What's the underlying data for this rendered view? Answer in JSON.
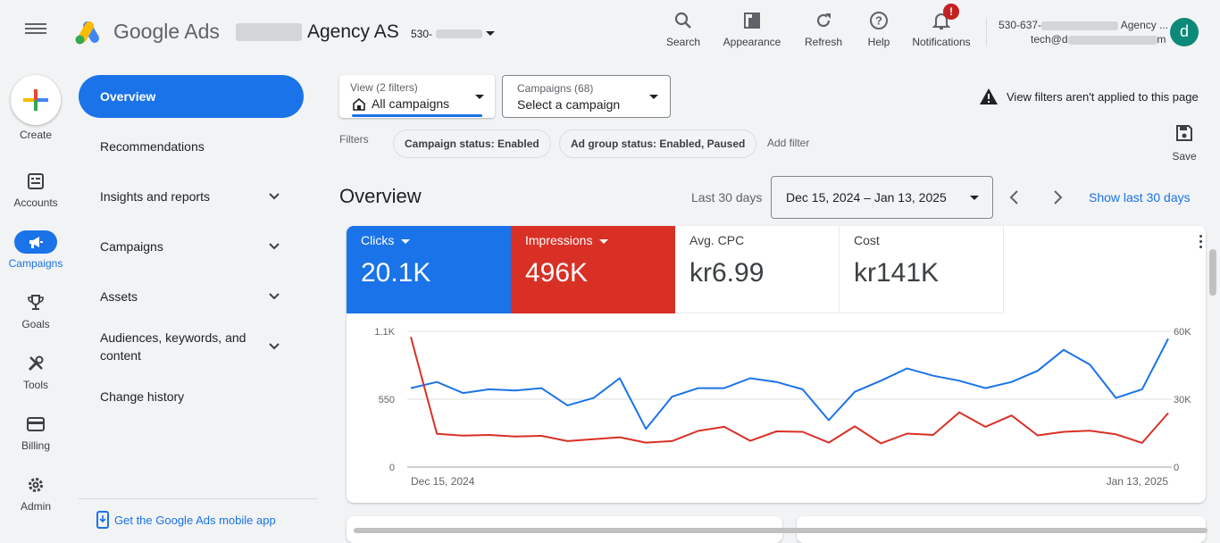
{
  "header": {
    "brand": "Google Ads",
    "account_name": "Agency AS",
    "account_id": "530-",
    "tools": [
      {
        "name": "search",
        "label": "Search"
      },
      {
        "name": "appearance",
        "label": "Appearance"
      },
      {
        "name": "refresh",
        "label": "Refresh"
      },
      {
        "name": "help",
        "label": "Help"
      },
      {
        "name": "notifications",
        "label": "Notifications",
        "badge": "!"
      }
    ],
    "user_account_line": "530-637-",
    "user_account_suffix": "Agency ...",
    "user_email_prefix": "tech@d",
    "user_email_suffix": "m",
    "avatar_letter": "d"
  },
  "rail": {
    "create_label": "Create",
    "items": [
      {
        "name": "accounts",
        "label": "Accounts"
      },
      {
        "name": "campaigns",
        "label": "Campaigns",
        "active": true
      },
      {
        "name": "goals",
        "label": "Goals"
      },
      {
        "name": "tools",
        "label": "Tools"
      },
      {
        "name": "billing",
        "label": "Billing"
      },
      {
        "name": "admin",
        "label": "Admin"
      }
    ]
  },
  "nav": {
    "items": [
      {
        "label": "Overview",
        "active": true
      },
      {
        "label": "Recommendations"
      },
      {
        "label": "Insights and reports",
        "expandable": true
      },
      {
        "label": "Campaigns",
        "expandable": true
      },
      {
        "label": "Assets",
        "expandable": true
      },
      {
        "label": "Audiences, keywords, and content",
        "expandable": true
      },
      {
        "label": "Change history"
      }
    ],
    "mobile_app_link": "Get the Google Ads mobile app"
  },
  "filters": {
    "view_label": "View (2 filters)",
    "view_value": "All campaigns",
    "campaigns_label": "Campaigns (68)",
    "campaigns_value": "Select a campaign",
    "warning": "View filters aren't applied to this page",
    "filters_label": "Filters",
    "chips": [
      "Campaign status: Enabled",
      "Ad group status: Enabled, Paused"
    ],
    "add_filter": "Add filter",
    "save_label": "Save"
  },
  "overview": {
    "title": "Overview",
    "range_label": "Last 30 days",
    "date_range": "Dec 15, 2024 – Jan 13, 2025",
    "show_last": "Show last 30 days"
  },
  "metrics": [
    {
      "label": "Clicks",
      "value": "20.1K",
      "color": "#1a73e8",
      "selected": true
    },
    {
      "label": "Impressions",
      "value": "496K",
      "color": "#d93025",
      "selected": true
    },
    {
      "label": "Avg. CPC",
      "value": "kr6.99",
      "selected": false
    },
    {
      "label": "Cost",
      "value": "kr141K",
      "selected": false
    }
  ],
  "chart_data": {
    "type": "line",
    "x_start": "Dec 15, 2024",
    "x_end": "Jan 13, 2025",
    "left_ticks": [
      "1.1K",
      "550",
      "0"
    ],
    "right_ticks": [
      "60K",
      "30K",
      "0"
    ],
    "left_ylim": [
      0,
      1100
    ],
    "right_ylim": [
      0,
      60000
    ],
    "grid": true,
    "series": [
      {
        "name": "Clicks",
        "axis": "left",
        "color": "#1a73e8",
        "values": [
          640,
          690,
          600,
          630,
          620,
          640,
          500,
          560,
          720,
          310,
          570,
          640,
          640,
          720,
          690,
          630,
          380,
          610,
          700,
          800,
          740,
          700,
          640,
          690,
          780,
          950,
          830,
          560,
          630,
          1040
        ]
      },
      {
        "name": "Impressions",
        "axis": "right",
        "color": "#d93025",
        "values": [
          57500,
          14700,
          13900,
          14200,
          13500,
          13800,
          11500,
          12300,
          13200,
          10800,
          11500,
          16000,
          17800,
          11600,
          15800,
          15600,
          10800,
          18000,
          10500,
          14800,
          14200,
          24200,
          17800,
          22800,
          14000,
          15600,
          16100,
          14500,
          10700,
          23900
        ]
      }
    ]
  }
}
